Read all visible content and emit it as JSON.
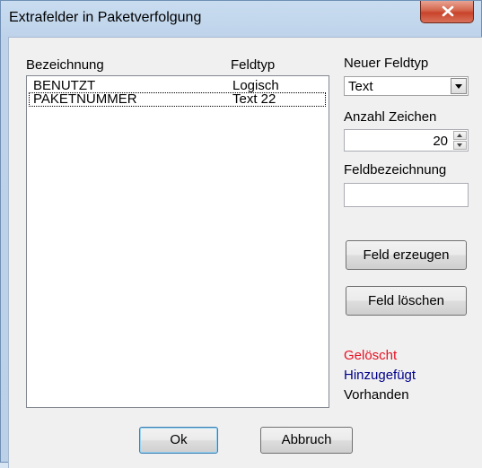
{
  "window": {
    "title": "Extrafelder in Paketverfolgung"
  },
  "list": {
    "col_name": "Bezeichnung",
    "col_type": "Feldtyp",
    "rows": [
      {
        "name": "BENUTZT",
        "type": "Logisch"
      },
      {
        "name": "PAKETNUMMER",
        "type": "Text 22"
      }
    ]
  },
  "form": {
    "new_type_label": "Neuer Feldtyp",
    "new_type_value": "Text",
    "char_count_label": "Anzahl Zeichen",
    "char_count_value": "20",
    "field_name_label": "Feldbezeichnung",
    "field_name_value": ""
  },
  "buttons": {
    "create": "Feld erzeugen",
    "delete": "Feld löschen",
    "ok": "Ok",
    "cancel": "Abbruch"
  },
  "legend": {
    "deleted": "Gelöscht",
    "added": "Hinzugefügt",
    "existing": "Vorhanden"
  },
  "colors": {
    "deleted": "#e81123",
    "added": "#00008b",
    "existing": "#000000"
  }
}
